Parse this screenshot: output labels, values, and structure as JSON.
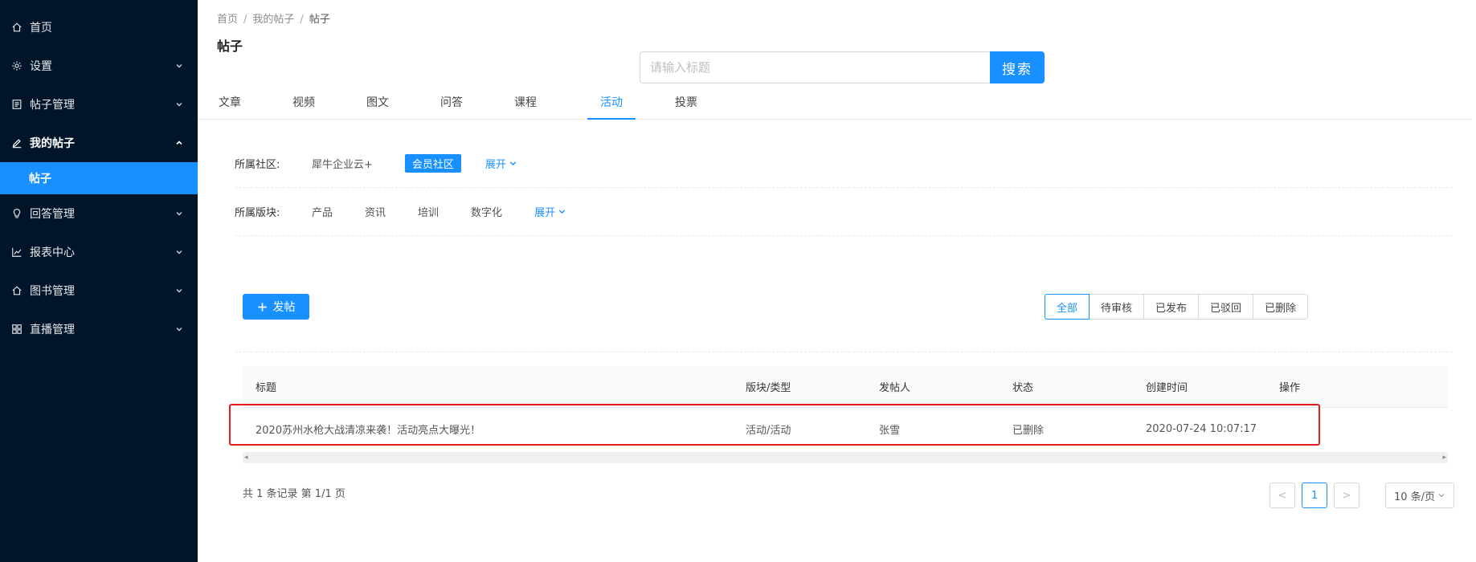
{
  "sidebar": {
    "items": [
      {
        "label": "首页",
        "icon": "home-icon",
        "chevron": ""
      },
      {
        "label": "设置",
        "icon": "gear-icon",
        "chevron": "down"
      },
      {
        "label": "帖子管理",
        "icon": "document-icon",
        "chevron": "down"
      },
      {
        "label": "我的帖子",
        "icon": "edit-icon",
        "chevron": "up"
      },
      {
        "label": "回答管理",
        "icon": "bulb-icon",
        "chevron": "down"
      },
      {
        "label": "报表中心",
        "icon": "line-chart-icon",
        "chevron": "down"
      },
      {
        "label": "图书管理",
        "icon": "home-icon",
        "chevron": "down"
      },
      {
        "label": "直播管理",
        "icon": "grid-icon",
        "chevron": "down"
      }
    ],
    "active_sub_item": "帖子"
  },
  "breadcrumb": {
    "items": [
      "首页",
      "我的帖子",
      "帖子"
    ],
    "separator": "/"
  },
  "page_title": "帖子",
  "search": {
    "placeholder": "请输入标题",
    "value": "",
    "button_label": "搜索"
  },
  "tabs": {
    "items": [
      "文章",
      "视频",
      "图文",
      "问答",
      "课程",
      "活动",
      "投票"
    ],
    "active": "活动"
  },
  "filters": {
    "community": {
      "label": "所属社区:",
      "options": [
        "犀牛企业云+",
        "会员社区"
      ],
      "selected": "会员社区",
      "expand_label": "展开"
    },
    "section": {
      "label": "所属版块:",
      "options": [
        "产品",
        "资讯",
        "培训",
        "数字化"
      ],
      "expand_label": "展开"
    }
  },
  "post_button_label": "发帖",
  "status_filter": {
    "options": [
      "全部",
      "待审核",
      "已发布",
      "已驳回",
      "已删除"
    ],
    "active": "全部"
  },
  "table": {
    "columns": [
      "标题",
      "版块/类型",
      "发帖人",
      "状态",
      "创建时间",
      "操作"
    ],
    "rows": [
      {
        "title": "2020苏州水枪大战清凉来袭！活动亮点大曝光！",
        "category": "活动/活动",
        "author": "张雪",
        "status": "已删除",
        "created": "2020-07-24 10:07:17",
        "action": ""
      }
    ]
  },
  "summary": "共 1 条记录 第 1/1 页",
  "pagination": {
    "prev": "<",
    "current": "1",
    "next": ">",
    "page_size": "10 条/页"
  },
  "colors": {
    "sidebar_bg": "#001529",
    "primary": "#1890ff",
    "highlight_border": "#e81c1c"
  }
}
